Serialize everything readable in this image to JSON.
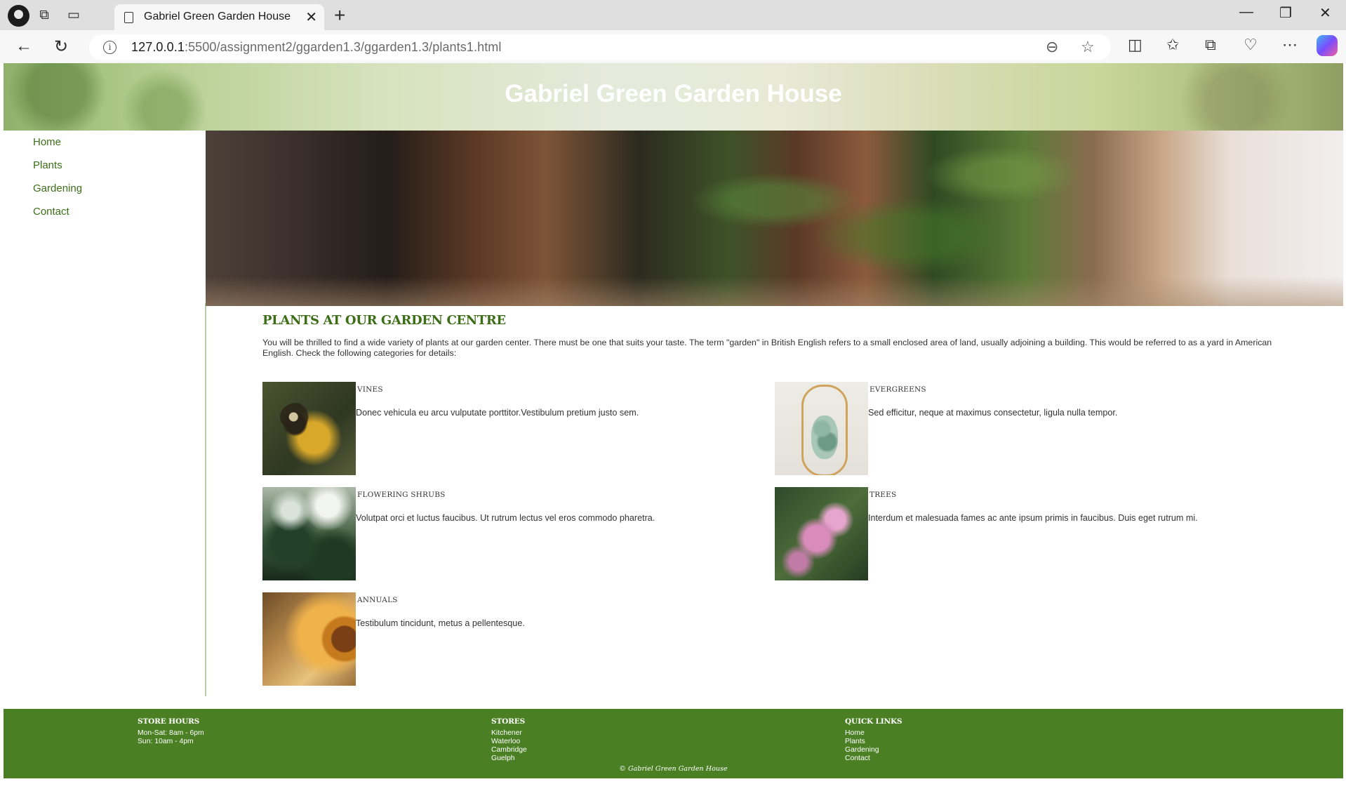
{
  "browser": {
    "tab_title": "Gabriel Green Garden House",
    "url_host": "127.0.0.1",
    "url_path": ":5500/assignment2/ggarden1.3/ggarden1.3/plants1.html"
  },
  "site": {
    "title": "Gabriel Green Garden House"
  },
  "nav": {
    "items": [
      "Home",
      "Plants",
      "Gardening",
      "Contact"
    ]
  },
  "main": {
    "heading": "PLANTS AT OUR GARDEN CENTRE",
    "intro": "You will be thrilled to find a wide variety of plants at our garden center. There must be one that suits your taste. The term \"garden\" in British English refers to a small enclosed area of land, usually adjoining a building. This would be referred to as a yard in American English. Check the following categories for details:"
  },
  "categories": [
    {
      "title": "VINES",
      "description": "Donec vehicula eu arcu vulputate porttitor.Vestibulum pretium justo sem."
    },
    {
      "title": "EVERGREENS",
      "description": "Sed efficitur, neque at maximus consectetur, ligula nulla tempor."
    },
    {
      "title": "FLOWERING SHRUBS",
      "description": "Volutpat orci et luctus faucibus. Ut rutrum lectus vel eros commodo pharetra."
    },
    {
      "title": "TREES",
      "description": "Interdum et malesuada fames ac ante ipsum primis in faucibus. Duis eget rutrum mi."
    },
    {
      "title": "ANNUALS",
      "description": "Testibulum tincidunt, metus a pellentesque."
    }
  ],
  "footer": {
    "hours_heading": "STORE HOURS",
    "hours": [
      "Mon-Sat: 8am - 6pm",
      "Sun: 10am - 4pm"
    ],
    "stores_heading": "STORES",
    "stores": [
      "Kitchener",
      "Waterloo",
      "Cambridge",
      "Guelph"
    ],
    "links_heading": "QUICK LINKS",
    "links": [
      "Home",
      "Plants",
      "Gardening",
      "Contact"
    ],
    "copyright": "© Gabriel Green Garden House"
  },
  "colors": {
    "brand_green": "#3b6e17",
    "footer_green": "#4b7f24"
  },
  "icons": {
    "tab": "page-icon",
    "close": "close-icon",
    "back": "back-arrow-icon",
    "reload": "reload-icon",
    "info": "info-icon",
    "zoom": "zoom-out-icon",
    "favorite": "star-icon"
  }
}
